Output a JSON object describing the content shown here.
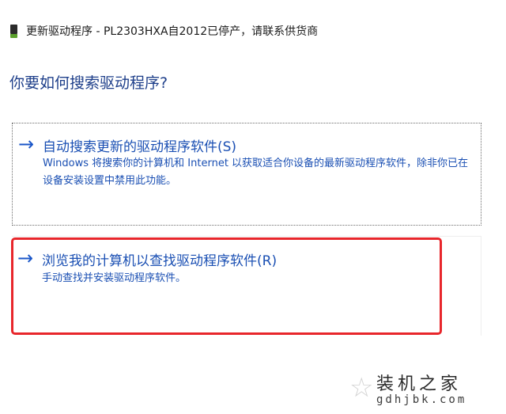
{
  "window": {
    "icon": "usb-device-icon",
    "title": "更新驱动程序 - PL2303HXA自2012已停产，请联系供货商"
  },
  "main": {
    "heading": "你要如何搜索驱动程序?",
    "options": [
      {
        "icon": "arrow-right-icon",
        "arrow": "→",
        "title": "自动搜索更新的驱动程序软件(S)",
        "description": "Windows 将搜索你的计算机和 Internet 以获取适合你设备的最新驱动程序软件，除非你已在设备安装设置中禁用此功能。"
      },
      {
        "icon": "arrow-right-icon",
        "arrow": "→",
        "title": "浏览我的计算机以查找驱动程序软件(R)",
        "description": "手动查找并安装驱动程序软件。",
        "highlight_color": "#e8262b"
      }
    ]
  },
  "watermark": {
    "icon": "star-icon",
    "star": "☆",
    "title": "装机之家",
    "url": "gdhjbk.com"
  }
}
